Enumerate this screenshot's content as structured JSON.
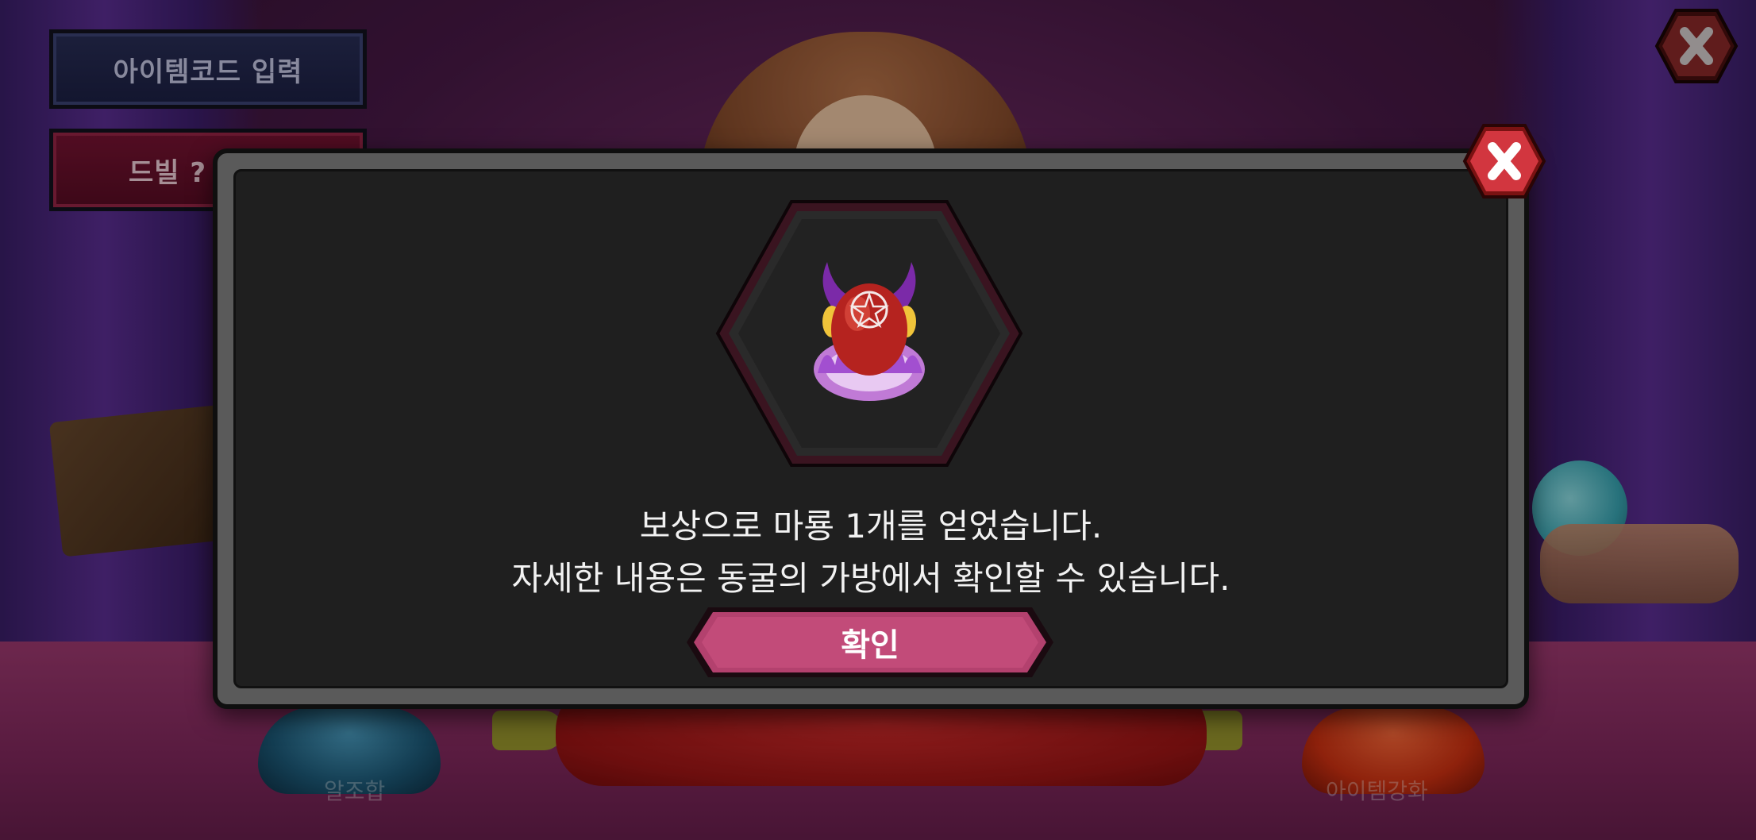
{
  "background": {
    "top_buttons": {
      "item_code_label": "아이템코드 입력",
      "drill_label_partial": "드빌 ?"
    },
    "bottom": {
      "left_orb_label": "알조합",
      "right_orb_label": "아이템강화"
    }
  },
  "dialog": {
    "reward_icon": "demon-horned-egg-icon",
    "message_line1": "보상으로 마룡 1개를 얻었습니다.",
    "message_line2": "자세한 내용은 동굴의 가방에서 확인할 수 있습니다.",
    "confirm_label": "확인"
  },
  "colors": {
    "confirm_button": "#b3416e",
    "close_button": "#d2363f",
    "dialog_bg": "#1f1f1f"
  }
}
